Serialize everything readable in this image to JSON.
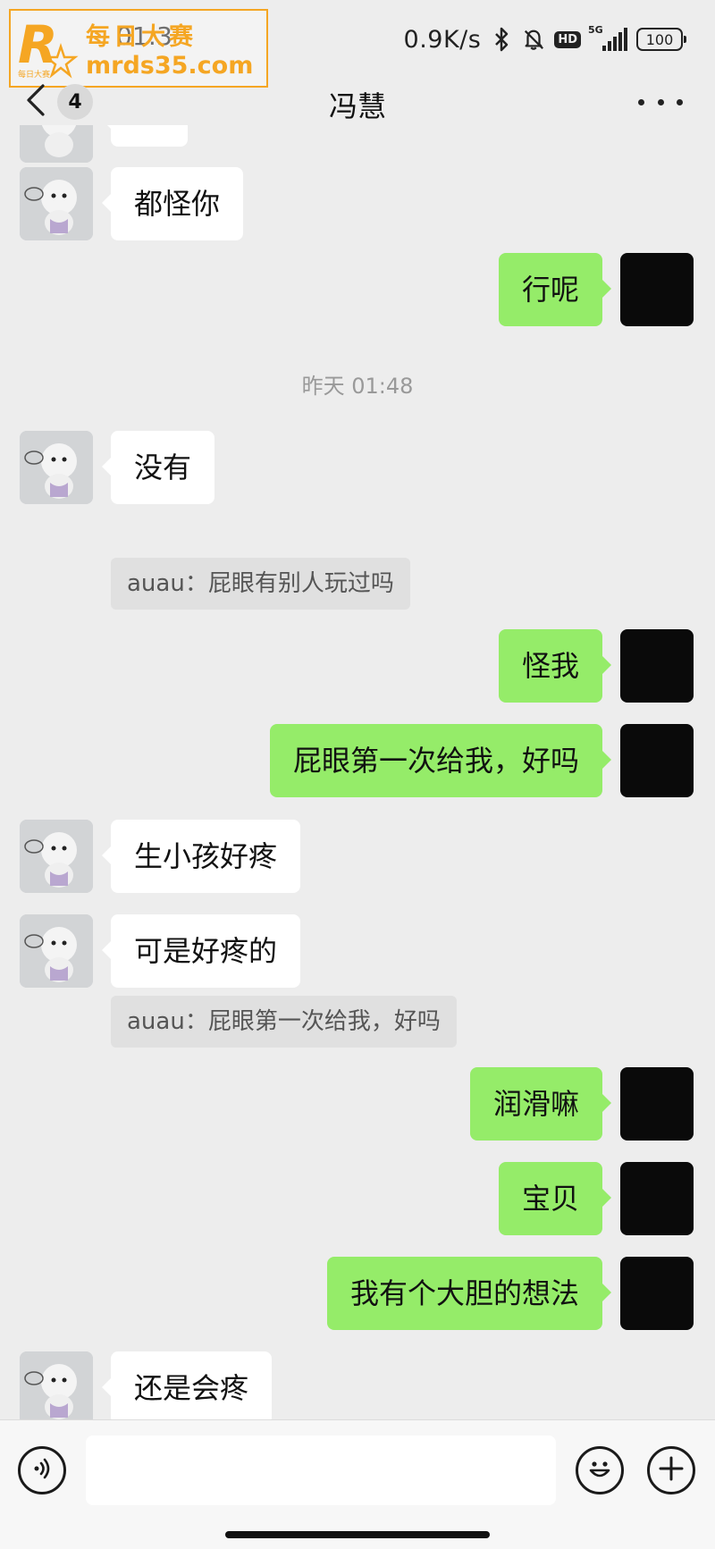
{
  "status_bar": {
    "time": "01:3",
    "net_speed": "0.9K/s",
    "network": "5G",
    "battery": "100",
    "icons": [
      "bluetooth-icon",
      "mute-bell-icon",
      "hd-icon",
      "signal-icon",
      "battery-icon"
    ]
  },
  "watermark": {
    "logo_letter": "R",
    "line1": "每日大赛",
    "line2": "mrds35.com",
    "logo_small": "每日大赛",
    "color": "#f5a623"
  },
  "nav": {
    "back_icon": "chevron-left-icon",
    "unread_count": "4",
    "title": "冯慧",
    "more_icon": "more-icon"
  },
  "messages": [
    {
      "side": "left",
      "text": "",
      "partial": true
    },
    {
      "side": "left",
      "text": "都怪你"
    },
    {
      "side": "right",
      "text": "行呢"
    },
    {
      "type": "time",
      "text": "昨天 01:48"
    },
    {
      "side": "left",
      "text": "没有",
      "quote": "auau：屁眼有别人玩过吗"
    },
    {
      "side": "right",
      "text": "怪我"
    },
    {
      "side": "right",
      "text": "屁眼第一次给我，好吗"
    },
    {
      "side": "left",
      "text": "生小孩好疼"
    },
    {
      "side": "left",
      "text": "可是好疼的",
      "quote": "auau：屁眼第一次给我，好吗"
    },
    {
      "side": "right",
      "text": "润滑嘛"
    },
    {
      "side": "right",
      "text": "宝贝"
    },
    {
      "side": "right",
      "text": "我有个大胆的想法"
    },
    {
      "side": "left",
      "text": "还是会疼"
    }
  ],
  "input_bar": {
    "voice_icon": "voice-icon",
    "text_value": "",
    "emoji_icon": "emoji-icon",
    "add_icon": "plus-icon"
  },
  "colors": {
    "background": "#ededed",
    "sent_bubble": "#95ec69",
    "received_bubble": "#ffffff"
  }
}
